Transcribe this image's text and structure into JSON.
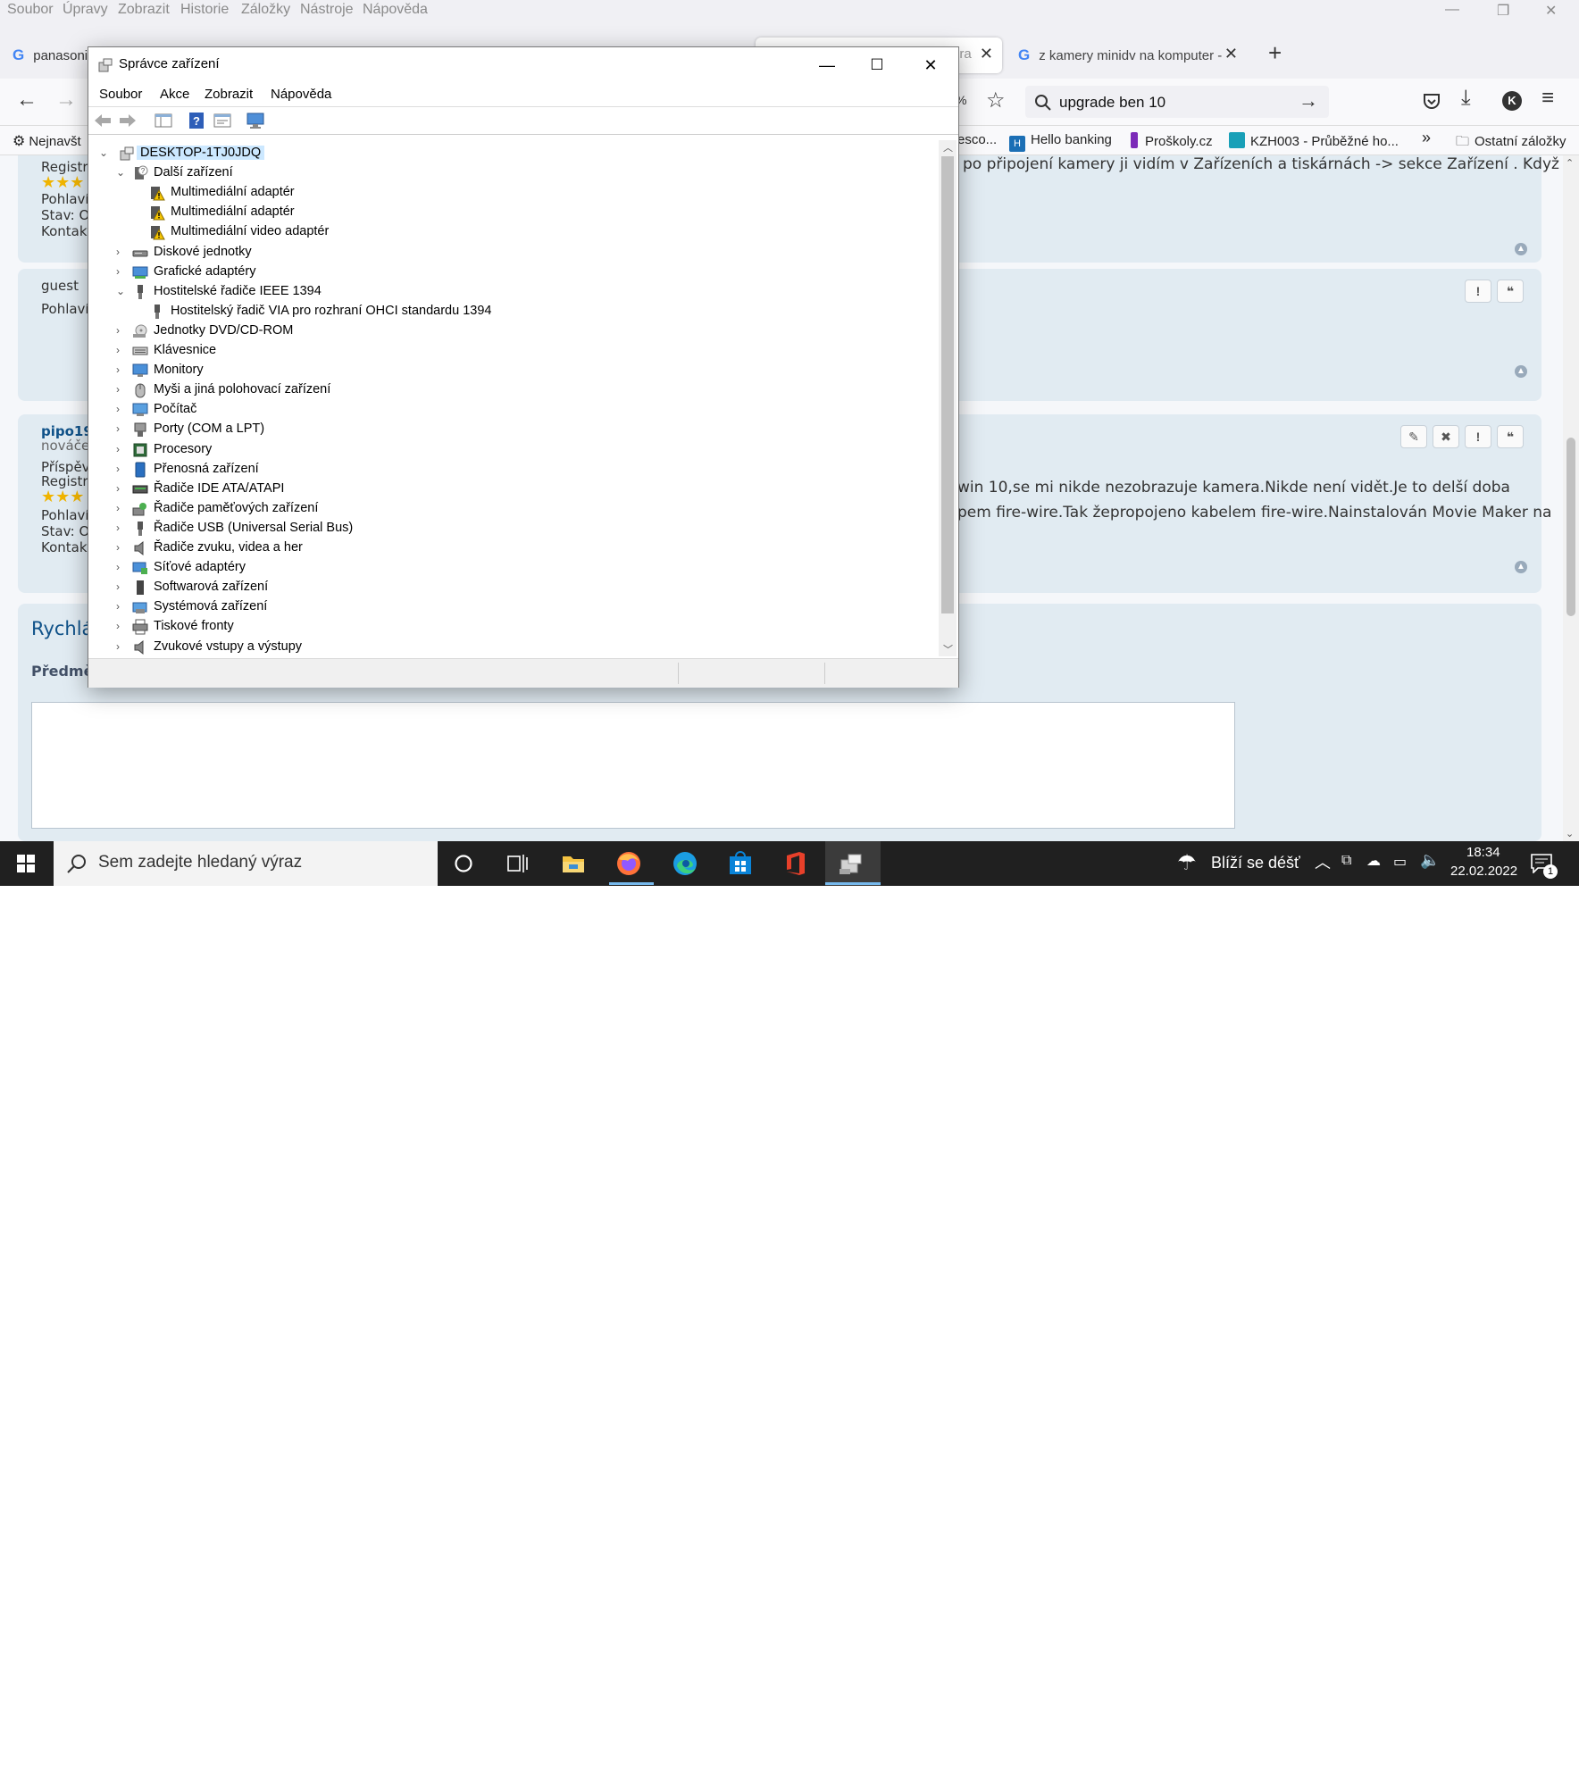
{
  "firefox": {
    "menu": [
      "Soubor",
      "Úpravy",
      "Zobrazit",
      "Historie",
      "Záložky",
      "Nástroje",
      "Nápověda"
    ],
    "tabs": [
      {
        "label": "panasoni"
      },
      {
        "label": "pra"
      },
      {
        "label": "z kamery minidv na komputer -"
      }
    ],
    "zoom": "%",
    "search_value": "upgrade ben 10",
    "bookmarks": [
      "Nejnavšt",
      "esco...",
      "Hello banking",
      "Proškoly.cz",
      "KZH003 - Průběžné ho...",
      "Ostatní záložky"
    ]
  },
  "page": {
    "post1": {
      "side": [
        "Registr",
        "Pohlaví:",
        "Stav: O",
        "Kontakt"
      ],
      "text": "po připojení kamery ji vidím v  Zařízeních a tiskárnách -> sekce Zařízení . Když"
    },
    "post2": {
      "author": "guest",
      "side": [
        "Pohlaví:"
      ],
      "btn_report": "!",
      "btn_quote": "❝"
    },
    "post3": {
      "author": "pipo19",
      "rank": "nováček",
      "side": [
        "Příspěvk",
        "Registr",
        "Pohlaví:",
        "Stav: O",
        "Kontakt"
      ],
      "line1": "win 10,se mi nikde nezobrazuje kamera.Nikde není vidět.Je to delší doba",
      "line2": "pem fire-wire.Tak žepropojeno kabelem fire-wire.Nainstalován Movie Maker na",
      "btn_edit": "✎",
      "btn_delete": "✖",
      "btn_report": "!",
      "btn_quote": "❝"
    },
    "quick_reply": {
      "title": "Rychlá",
      "subject_label": "Předmě"
    }
  },
  "taskbar": {
    "search_placeholder": "Sem zadejte hledaný výraz",
    "weather": "Blíží se déšť",
    "time": "18:34",
    "date": "22.02.2022",
    "notif_count": "1"
  },
  "device_manager": {
    "title": "Správce zařízení",
    "menu": [
      "Soubor",
      "Akce",
      "Zobrazit",
      "Nápověda"
    ],
    "root": "DESKTOP-1TJ0JDQ",
    "tree": [
      {
        "label": "Další zařízení",
        "level": 1,
        "expanded": true,
        "icon": "unknown-device-icon"
      },
      {
        "label": "Multimediální adaptér",
        "level": 2,
        "icon": "warning-device-icon"
      },
      {
        "label": "Multimediální adaptér",
        "level": 2,
        "icon": "warning-device-icon"
      },
      {
        "label": "Multimediální video adaptér",
        "level": 2,
        "icon": "warning-device-icon"
      },
      {
        "label": "Diskové jednotky",
        "level": 1,
        "expanded": false,
        "icon": "disk-drive-icon"
      },
      {
        "label": "Grafické adaptéry",
        "level": 1,
        "expanded": false,
        "icon": "display-adapter-icon"
      },
      {
        "label": "Hostitelské řadiče IEEE 1394",
        "level": 1,
        "expanded": true,
        "icon": "plug-icon"
      },
      {
        "label": "Hostitelský řadič VIA pro rozhraní OHCI standardu 1394",
        "level": 2,
        "icon": "plug-icon"
      },
      {
        "label": "Jednotky DVD/CD-ROM",
        "level": 1,
        "expanded": false,
        "icon": "dvd-drive-icon"
      },
      {
        "label": "Klávesnice",
        "level": 1,
        "expanded": false,
        "icon": "keyboard-icon"
      },
      {
        "label": "Monitory",
        "level": 1,
        "expanded": false,
        "icon": "monitor-icon"
      },
      {
        "label": "Myši a jiná polohovací zařízení",
        "level": 1,
        "expanded": false,
        "icon": "mouse-icon"
      },
      {
        "label": "Počítač",
        "level": 1,
        "expanded": false,
        "icon": "computer-icon"
      },
      {
        "label": "Porty (COM a LPT)",
        "level": 1,
        "expanded": false,
        "icon": "port-icon"
      },
      {
        "label": "Procesory",
        "level": 1,
        "expanded": false,
        "icon": "processor-icon"
      },
      {
        "label": "Přenosná zařízení",
        "level": 1,
        "expanded": false,
        "icon": "portable-device-icon"
      },
      {
        "label": "Řadiče IDE ATA/ATAPI",
        "level": 1,
        "expanded": false,
        "icon": "ide-controller-icon"
      },
      {
        "label": "Řadiče paměťových zařízení",
        "level": 1,
        "expanded": false,
        "icon": "storage-controller-icon"
      },
      {
        "label": "Řadiče USB (Universal Serial Bus)",
        "level": 1,
        "expanded": false,
        "icon": "usb-icon"
      },
      {
        "label": "Řadiče zvuku, videa a her",
        "level": 1,
        "expanded": false,
        "icon": "speaker-icon"
      },
      {
        "label": "Síťové adaptéry",
        "level": 1,
        "expanded": false,
        "icon": "network-adapter-icon"
      },
      {
        "label": "Softwarová zařízení",
        "level": 1,
        "expanded": false,
        "icon": "software-device-icon"
      },
      {
        "label": "Systémová zařízení",
        "level": 1,
        "expanded": false,
        "icon": "system-device-icon"
      },
      {
        "label": "Tiskové fronty",
        "level": 1,
        "expanded": false,
        "icon": "printer-icon"
      },
      {
        "label": "Zvukové vstupy a výstupy",
        "level": 1,
        "expanded": false,
        "icon": "audio-io-icon"
      }
    ]
  }
}
